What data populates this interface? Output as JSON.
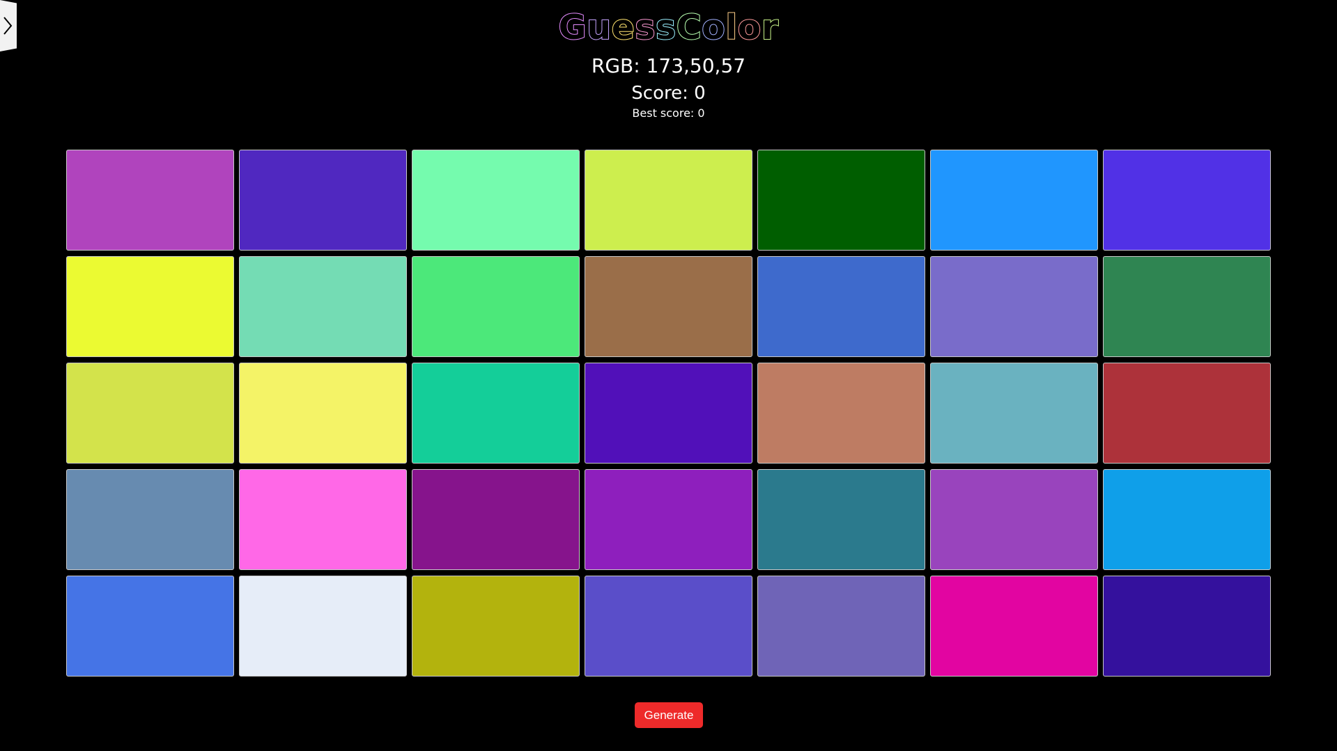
{
  "sidebar_toggle": {
    "icon": "chevron-right-icon"
  },
  "header": {
    "title_letters": [
      "G",
      "u",
      "e",
      "s",
      "s",
      "C",
      "o",
      "l",
      "o",
      "r"
    ],
    "rgb_text": "RGB: 173,50,57",
    "score_text": "Score: 0",
    "best_score_text": "Best score: 0"
  },
  "tiles": [
    "#b044bd",
    "#5028c0",
    "#75fbae",
    "#cdee4e",
    "#005e00",
    "#2096fe",
    "#5131e6",
    "#ebfa32",
    "#74dcb4",
    "#4ce87a",
    "#9a6e49",
    "#3e6acc",
    "#796cca",
    "#2f8552",
    "#d3e34b",
    "#f4f367",
    "#14ce99",
    "#5110b9",
    "#be7c63",
    "#6ab2c0",
    "#ad323a",
    "#678bb0",
    "#ff68e7",
    "#86148c",
    "#8e1fbd",
    "#2b7a8d",
    "#9944bd",
    "#0f9fe9",
    "#4574e6",
    "#e6edf8",
    "#b3b30d",
    "#5a4ec9",
    "#6f64b7",
    "#e205a1",
    "#34119d"
  ],
  "actions": {
    "generate_label": "Generate",
    "generate_color": "#ee2a2a"
  }
}
